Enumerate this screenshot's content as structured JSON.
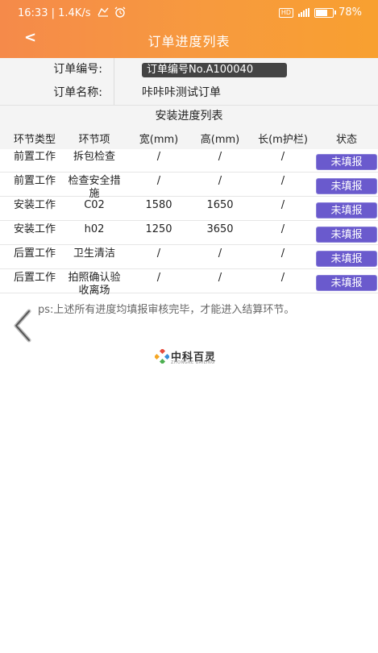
{
  "statusbar": {
    "time": "16:33",
    "speed": "1.4K/s",
    "hd": "HD",
    "battery": "78%",
    "battery_level": 0.78
  },
  "header": {
    "back_label": "<",
    "title": "订单进度列表"
  },
  "order": {
    "number_label": "订单编号:",
    "number_value": "订单编号No.A100040",
    "name_label": "订单名称:",
    "name_value": "咔咔咔测试订单"
  },
  "table": {
    "title": "安装进度列表",
    "columns": [
      "环节类型",
      "环节项",
      "宽(mm)",
      "高(mm)",
      "长(m护栏)",
      "状态"
    ],
    "rows": [
      {
        "type": "前置工作",
        "item": "拆包检查",
        "width": "/",
        "height": "/",
        "length": "/",
        "status": "未填报"
      },
      {
        "type": "前置工作",
        "item": "检查安全措施",
        "width": "/",
        "height": "/",
        "length": "/",
        "status": "未填报"
      },
      {
        "type": "安装工作",
        "item": "C02",
        "width": "1580",
        "height": "1650",
        "length": "/",
        "status": "未填报"
      },
      {
        "type": "安装工作",
        "item": "h02",
        "width": "1250",
        "height": "3650",
        "length": "/",
        "status": "未填报"
      },
      {
        "type": "后置工作",
        "item": "卫生清洁",
        "width": "/",
        "height": "/",
        "length": "/",
        "status": "未填报"
      },
      {
        "type": "后置工作",
        "item": "拍照确认验收离场",
        "width": "/",
        "height": "/",
        "length": "/",
        "status": "未填报"
      }
    ]
  },
  "note": "ps:上述所有进度均填报审核完毕，才能进入结算环节。",
  "logo": {
    "name": "中科百灵",
    "sub": "ZHONGKE BAILING"
  },
  "colors": {
    "header_start": "#f58a4a",
    "header_end": "#f8a030",
    "status_button": "#6a5acd"
  }
}
